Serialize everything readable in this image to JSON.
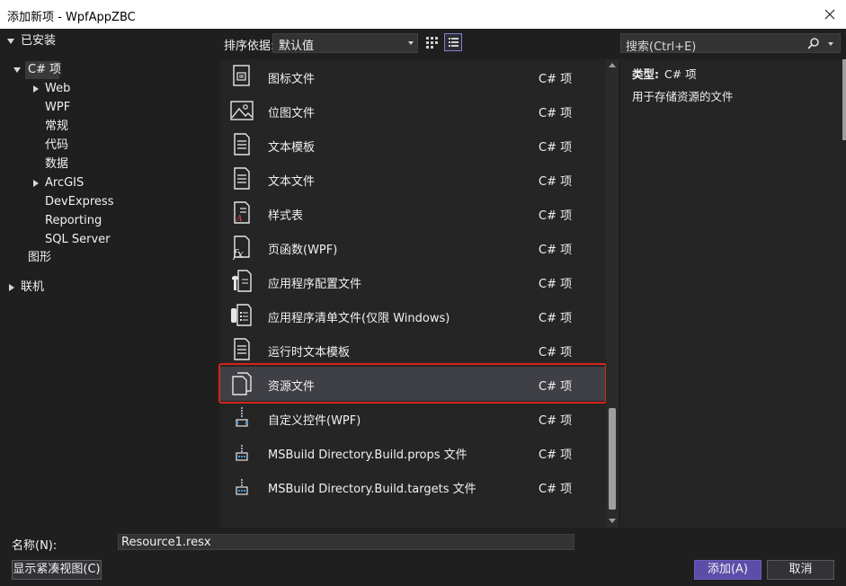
{
  "window": {
    "title": "添加新项 - WpfAppZBC"
  },
  "tree": {
    "installed": "已安装",
    "csharp": "C# 项",
    "web": "Web",
    "wpf": "WPF",
    "general": "常规",
    "code": "代码",
    "data": "数据",
    "arcgis": "ArcGIS",
    "devexpress": "DevExpress",
    "reporting": "Reporting",
    "sql_server": "SQL Server",
    "graphics": "图形",
    "online": "联机"
  },
  "toolbar": {
    "sort_label": "排序依据:",
    "sort_value": "默认值"
  },
  "search": {
    "placeholder": "搜索(Ctrl+E)"
  },
  "templates": [
    {
      "name": "图标文件",
      "lang": "C# 项",
      "icon": "icon-file-icon"
    },
    {
      "name": "位图文件",
      "lang": "C# 项",
      "icon": "bitmap-file-icon"
    },
    {
      "name": "文本模板",
      "lang": "C# 项",
      "icon": "text-template-icon"
    },
    {
      "name": "文本文件",
      "lang": "C# 项",
      "icon": "text-file-icon"
    },
    {
      "name": "样式表",
      "lang": "C# 项",
      "icon": "stylesheet-icon"
    },
    {
      "name": "页函数(WPF)",
      "lang": "C# 项",
      "icon": "page-function-icon"
    },
    {
      "name": "应用程序配置文件",
      "lang": "C# 项",
      "icon": "app-config-icon"
    },
    {
      "name": "应用程序清单文件(仅限 Windows)",
      "lang": "C# 项",
      "icon": "app-manifest-icon"
    },
    {
      "name": "运行时文本模板",
      "lang": "C# 项",
      "icon": "runtime-template-icon"
    },
    {
      "name": "资源文件",
      "lang": "C# 项",
      "icon": "resource-file-icon",
      "selected": true
    },
    {
      "name": "自定义控件(WPF)",
      "lang": "C# 项",
      "icon": "custom-control-icon"
    },
    {
      "name": "MSBuild Directory.Build.props 文件",
      "lang": "C# 项",
      "icon": "msbuild-icon"
    },
    {
      "name": "MSBuild Directory.Build.targets 文件",
      "lang": "C# 项",
      "icon": "msbuild-icon"
    }
  ],
  "details": {
    "type_label": "类型:",
    "type_value": "C# 项",
    "description": "用于存储资源的文件"
  },
  "footer": {
    "name_label": "名称(N):",
    "name_value": "Resource1.resx",
    "compact_view": "显示紧凑视图(C)",
    "add": "添加(A)",
    "cancel": "取消"
  },
  "colors": {
    "accent": "#5c4da8",
    "highlight": "#d4251b",
    "background": "#1f1f1f"
  }
}
